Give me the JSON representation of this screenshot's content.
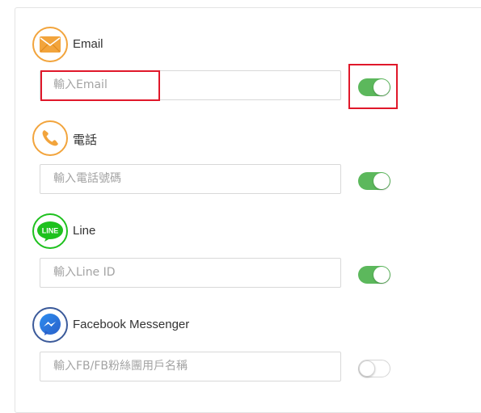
{
  "colors": {
    "toggle_on": "#5cb85c",
    "highlight": "#e0182a",
    "email_ring": "#f2a43c",
    "phone_ring": "#f2a43c",
    "line_ring": "#1ec11e",
    "messenger_ring": "#3b5a9a"
  },
  "channels": [
    {
      "name": "Email",
      "icon": "envelope-icon",
      "placeholder": "輸入Email",
      "enabled": true
    },
    {
      "name": "電話",
      "icon": "phone-icon",
      "placeholder": "輸入電話號碼",
      "enabled": true
    },
    {
      "name": "Line",
      "icon": "line-icon",
      "icon_text": "LINE",
      "placeholder": "輸入Line ID",
      "enabled": true
    },
    {
      "name": "Facebook Messenger",
      "icon": "messenger-icon",
      "placeholder": "輸入FB/FB粉絲團用戶名稱",
      "enabled": false
    }
  ]
}
